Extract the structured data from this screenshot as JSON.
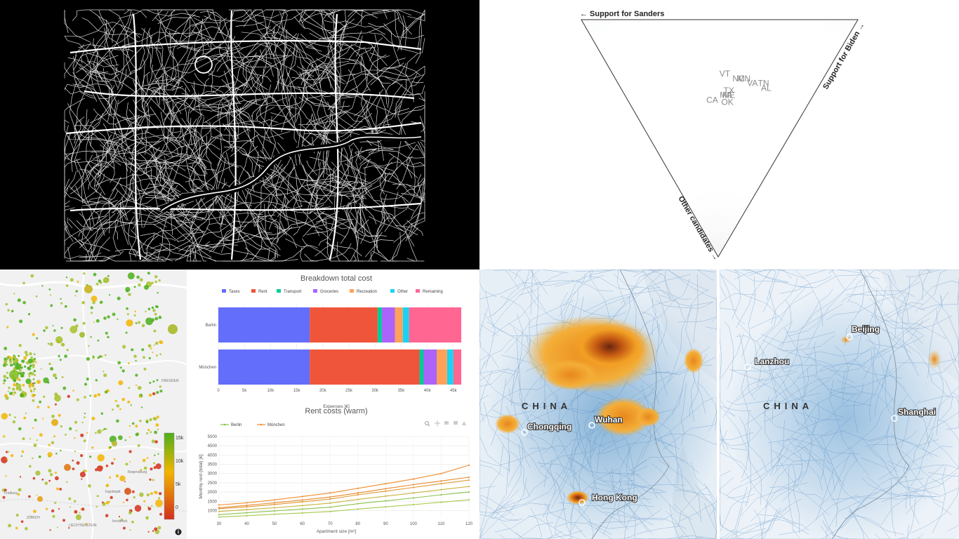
{
  "triangle": {
    "label_left": "← Support for Sanders",
    "label_right": "Support for Biden →",
    "label_bottom": "Other candidates →",
    "states": [
      {
        "code": "TN",
        "sanders": 0.2,
        "biden": 0.52
      },
      {
        "code": "AL",
        "sanders": 0.18,
        "biden": 0.52
      },
      {
        "code": "VA",
        "sanders": 0.24,
        "biden": 0.48
      },
      {
        "code": "MN",
        "sanders": 0.28,
        "biden": 0.46
      },
      {
        "code": "NC",
        "sanders": 0.3,
        "biden": 0.44
      },
      {
        "code": "VT",
        "sanders": 0.36,
        "biden": 0.4
      },
      {
        "code": "TX",
        "sanders": 0.31,
        "biden": 0.38
      },
      {
        "code": "ME",
        "sanders": 0.3,
        "biden": 0.37
      },
      {
        "code": "MA",
        "sanders": 0.31,
        "biden": 0.36
      },
      {
        "code": "OK",
        "sanders": 0.29,
        "biden": 0.35
      },
      {
        "code": "CA",
        "sanders": 0.35,
        "biden": 0.3
      }
    ]
  },
  "germany": {
    "scale_ticks": [
      "15k",
      "10k",
      "5k",
      "0"
    ],
    "info_icon": "info-icon",
    "colors": {
      "high": "#4caf1a",
      "mid": "#f2b500",
      "low": "#d2301b"
    },
    "town_labels": [
      "DRESDEN",
      "Regensburg",
      "Ingolstadt",
      "Freiburg",
      "ZÜRICH",
      "LIECHTENSTEIN",
      "Innsbruck"
    ]
  },
  "chart_data": [
    {
      "type": "bar",
      "orientation": "horizontal",
      "stacked": true,
      "title": "Breakdown total cost",
      "xlabel": "Expenses [€]",
      "xlim": [
        0,
        46500
      ],
      "x_ticks": [
        0,
        5000,
        10000,
        15000,
        20000,
        25000,
        30000,
        35000,
        40000,
        45000
      ],
      "x_tick_labels": [
        "0",
        "5k",
        "10k",
        "15k",
        "20k",
        "25k",
        "30k",
        "35k",
        "40k",
        "45k"
      ],
      "categories": [
        "Berlin",
        "München"
      ],
      "legend_position": "top",
      "series": [
        {
          "name": "Taxes",
          "color": "#636efa",
          "values": [
            17500,
            17500
          ]
        },
        {
          "name": "Rent",
          "color": "#ef553b",
          "values": [
            13000,
            21000
          ]
        },
        {
          "name": "Transport",
          "color": "#00cc96",
          "values": [
            800,
            800
          ]
        },
        {
          "name": "Groceries",
          "color": "#ab63fa",
          "values": [
            2500,
            2500
          ]
        },
        {
          "name": "Recreation",
          "color": "#ffa15a",
          "values": [
            1500,
            2000
          ]
        },
        {
          "name": "Other",
          "color": "#19d3f3",
          "values": [
            1200,
            1200
          ]
        },
        {
          "name": "Remaining",
          "color": "#ff6692",
          "values": [
            10000,
            1500
          ]
        }
      ]
    },
    {
      "type": "line",
      "title": "Rent costs (warm)",
      "xlabel": "Apartment size [m²]",
      "ylabel": "Monthly rent (total) [€]",
      "xlim": [
        30,
        120
      ],
      "ylim": [
        600,
        5000
      ],
      "x": [
        30,
        40,
        50,
        60,
        70,
        80,
        90,
        100,
        110,
        120
      ],
      "x_ticks": [
        30,
        40,
        50,
        60,
        70,
        80,
        90,
        100,
        110,
        120
      ],
      "y_ticks": [
        1000,
        1500,
        2000,
        2500,
        3000,
        3500,
        4000,
        4500,
        5000
      ],
      "legend_position": "top-left",
      "legend": [
        {
          "name": "Berlin",
          "color": "#8bc34a"
        },
        {
          "name": "München",
          "color": "#f08c2c"
        }
      ],
      "series": [
        {
          "color": "#a6c94a",
          "values": [
            650,
            720,
            800,
            870,
            950,
            1080,
            1200,
            1320,
            1450,
            1580
          ]
        },
        {
          "color": "#8bc34a",
          "values": [
            780,
            880,
            980,
            1080,
            1180,
            1370,
            1520,
            1680,
            1850,
            2000
          ]
        },
        {
          "color": "#c8b340",
          "values": [
            950,
            1050,
            1150,
            1270,
            1400,
            1600,
            1780,
            1950,
            2130,
            2300
          ]
        },
        {
          "color": "#e0962e",
          "values": [
            1100,
            1200,
            1330,
            1470,
            1620,
            1850,
            2050,
            2250,
            2450,
            2650
          ]
        },
        {
          "color": "#e5872c",
          "values": [
            1150,
            1280,
            1420,
            1570,
            1730,
            1950,
            2180,
            2400,
            2600,
            2800
          ]
        },
        {
          "color": "#f08c2c",
          "values": [
            1300,
            1420,
            1580,
            1760,
            1950,
            2200,
            2450,
            2700,
            3000,
            3450
          ]
        }
      ]
    }
  ],
  "china": {
    "country_label": "CHINA",
    "left_cities": [
      {
        "name": "Chongqing"
      },
      {
        "name": "Wuhan"
      },
      {
        "name": "Hong Kong"
      }
    ],
    "right_cities": [
      {
        "name": "Beijing"
      },
      {
        "name": "Lanzhou"
      },
      {
        "name": "Shanghai"
      }
    ],
    "colors": {
      "land": "#e9f0f6",
      "roads": "#4a86c0",
      "no2_high": "#f29a1c",
      "no2_peak": "#5a1c08"
    }
  }
}
